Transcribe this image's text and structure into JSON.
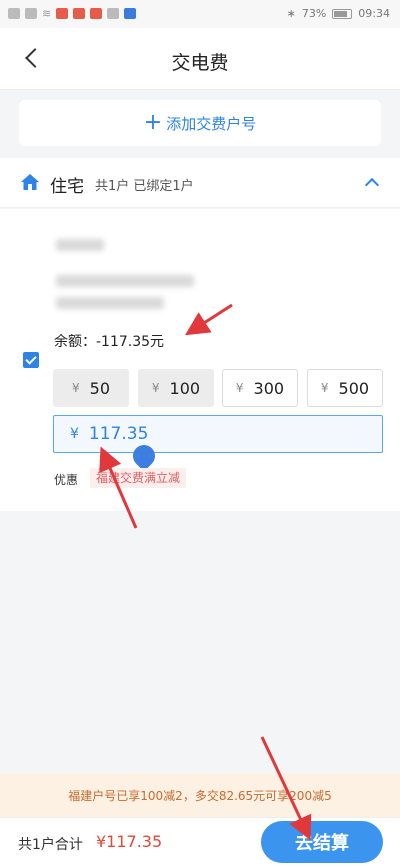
{
  "status_bar": {
    "battery": "73%",
    "time": "09:34"
  },
  "header": {
    "title": "交电费"
  },
  "add_account": {
    "label": "添加交费户号"
  },
  "residence": {
    "label": "住宅",
    "summary": "共1户 已绑定1户"
  },
  "account": {
    "balance_label": "余额：",
    "balance_value": "-117.35元",
    "amount_options": [
      {
        "currency": "¥",
        "value": "50"
      },
      {
        "currency": "¥",
        "value": "100"
      },
      {
        "currency": "¥",
        "value": "300"
      },
      {
        "currency": "¥",
        "value": "500"
      }
    ],
    "input": {
      "currency": "¥",
      "value": "117.35"
    },
    "promo_label": "优惠",
    "promo_tag": "福建交费满立减"
  },
  "notice": {
    "text": "福建户号已享100减2，多交82.65元可享200减5"
  },
  "footer": {
    "total_label": "共1户合计",
    "total_value": "¥117.35",
    "pay_button": "去结算"
  },
  "colors": {
    "accent": "#2d83e8",
    "price": "#e04a3a",
    "annotation": "#e0383b"
  }
}
